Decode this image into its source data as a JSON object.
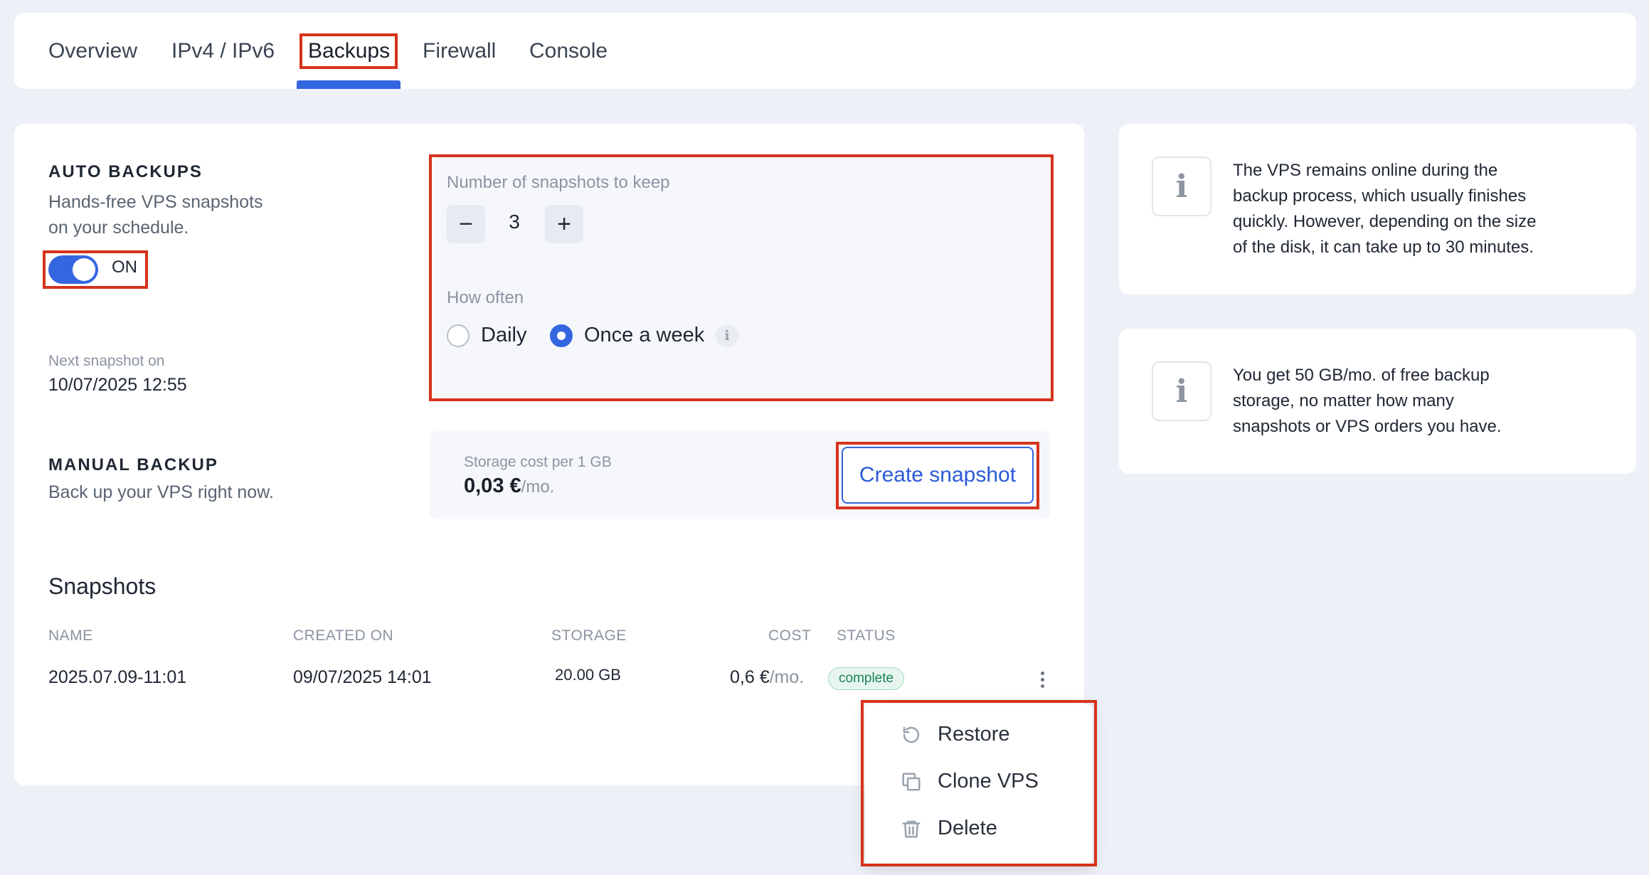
{
  "tabs": [
    {
      "label": "Overview"
    },
    {
      "label": "IPv4 / IPv6"
    },
    {
      "label": "Backups"
    },
    {
      "label": "Firewall"
    },
    {
      "label": "Console"
    }
  ],
  "active_tab": "Backups",
  "auto_backups": {
    "title": "AUTO BACKUPS",
    "desc_line1": "Hands-free VPS snapshots",
    "desc_line2": "on your schedule.",
    "toggle_label": "ON",
    "next_label": "Next snapshot on",
    "next_value": "10/07/2025 12:55"
  },
  "settings": {
    "keep_label": "Number of snapshots to keep",
    "keep_value": "3",
    "minus": "−",
    "plus": "+",
    "often_label": "How often",
    "options": [
      "Daily",
      "Once a week"
    ],
    "selected": "Once a week"
  },
  "manual_backup": {
    "title": "MANUAL BACKUP",
    "desc": "Back up your VPS right now.",
    "cost_label": "Storage cost per 1 GB",
    "cost_value": "0,03",
    "cost_currency": "€",
    "cost_unit": "/mo.",
    "button": "Create snapshot"
  },
  "snapshots": {
    "title": "Snapshots",
    "columns": [
      "NAME",
      "CREATED ON",
      "STORAGE",
      "COST",
      "STATUS"
    ],
    "rows": [
      {
        "name": "2025.07.09-11:01",
        "created": "09/07/2025 14:01",
        "storage": "20.00 GB",
        "cost": "0,6 €",
        "cost_unit": "/mo.",
        "status": "complete"
      }
    ]
  },
  "menu": {
    "items": [
      {
        "label": "Restore",
        "icon": "restore-icon"
      },
      {
        "label": "Clone VPS",
        "icon": "clone-icon"
      },
      {
        "label": "Delete",
        "icon": "trash-icon"
      }
    ]
  },
  "info": {
    "card1": [
      "The VPS remains online during the",
      "backup process, which usually finishes",
      "quickly. However, depending on the size",
      "of the disk, it can take up to 30 minutes."
    ],
    "card2": [
      "You get 50 GB/mo. of free backup",
      "storage, no matter how many",
      "snapshots or VPS orders you have."
    ],
    "icon_glyph": "i"
  },
  "colors": {
    "accent": "#3466e0",
    "highlight": "#d6321c",
    "background": "#edf1f7",
    "status_complete": "#1c7f5a"
  }
}
